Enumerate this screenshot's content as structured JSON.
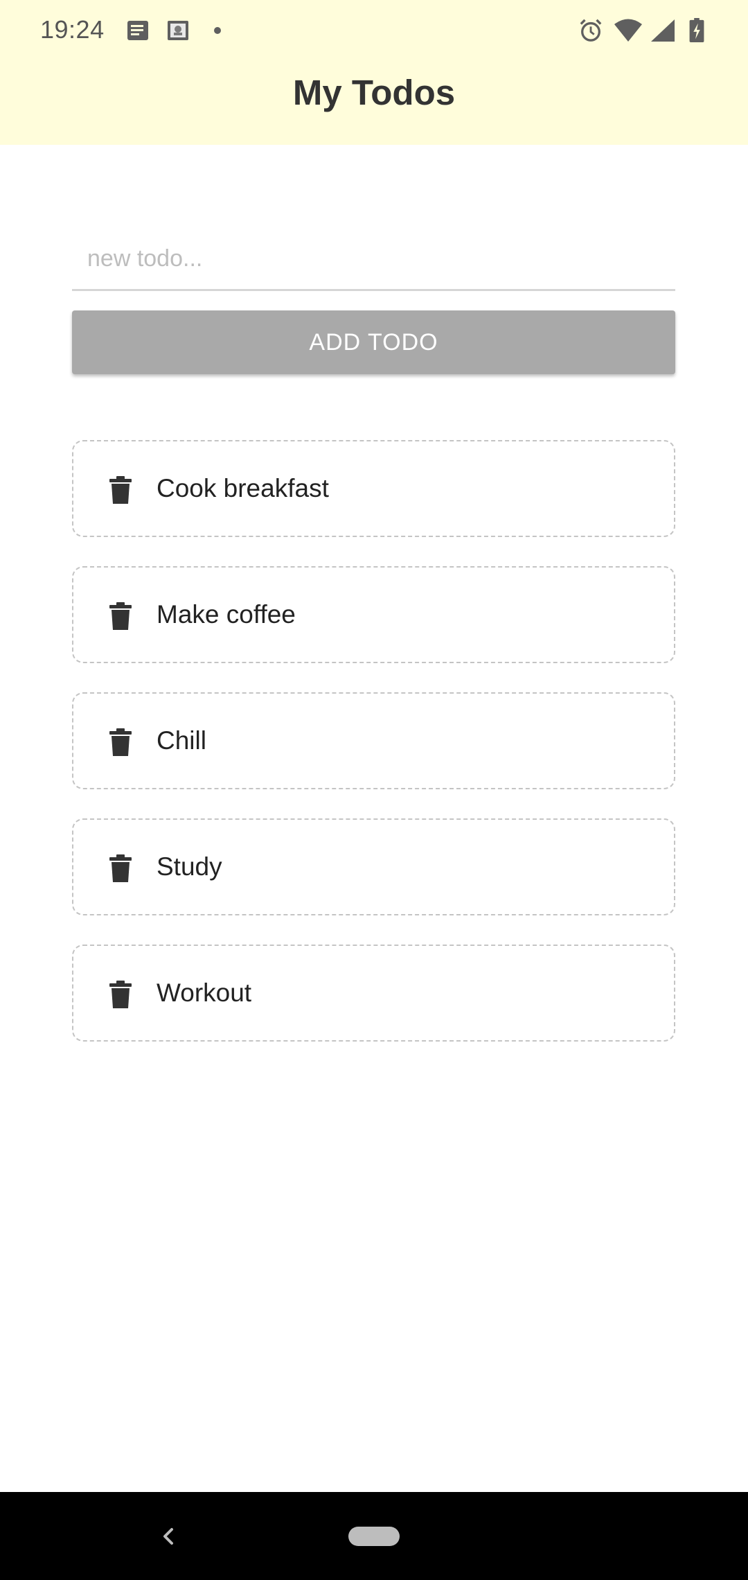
{
  "status_bar": {
    "time": "19:24",
    "left_icons": [
      "news-icon",
      "notification-app-icon",
      "dot-icon"
    ],
    "right_icons": [
      "alarm-icon",
      "wifi-icon",
      "cell-signal-icon",
      "battery-charging-icon"
    ]
  },
  "app": {
    "title": "My Todos"
  },
  "new_todo": {
    "value": "",
    "placeholder": "new todo..."
  },
  "add_button": {
    "label": "ADD TODO"
  },
  "todos": [
    {
      "text": "Cook breakfast",
      "icon": "trash-icon"
    },
    {
      "text": "Make coffee",
      "icon": "trash-icon"
    },
    {
      "text": "Chill",
      "icon": "trash-icon"
    },
    {
      "text": "Study",
      "icon": "trash-icon"
    },
    {
      "text": "Workout",
      "icon": "trash-icon"
    }
  ],
  "colors": {
    "header_background": "#fffddb",
    "button_background": "#a9a9a9",
    "border_dashed": "#c4c4c4",
    "text_dark": "#222222"
  }
}
